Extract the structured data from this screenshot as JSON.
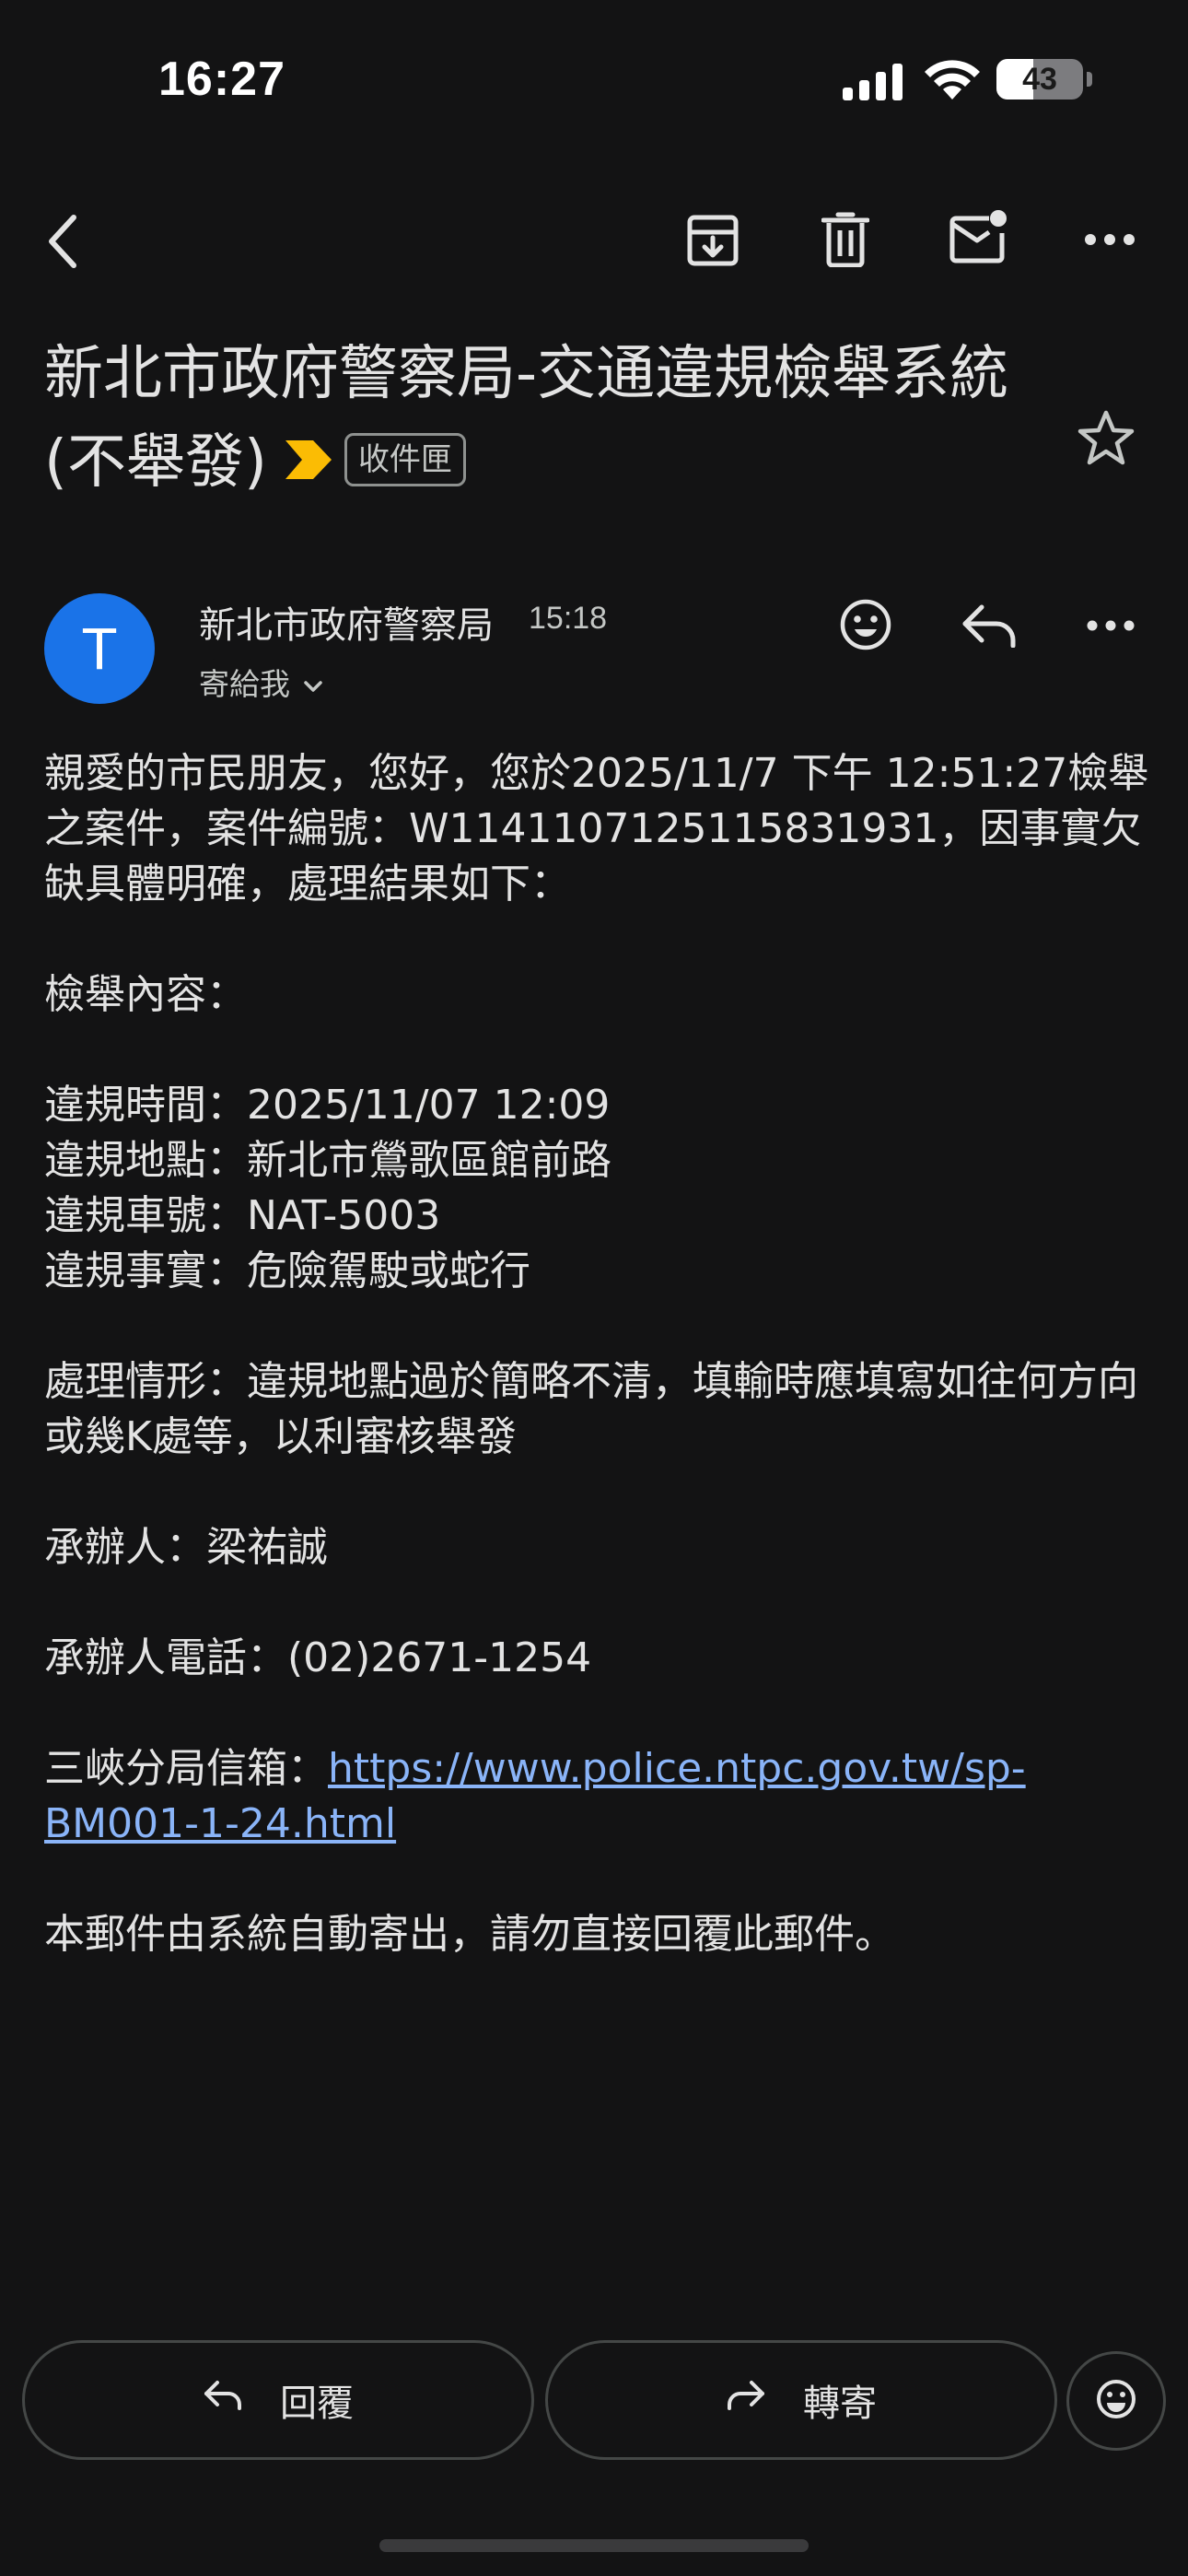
{
  "status_bar": {
    "time": "16:27",
    "battery_level": "43",
    "icons": [
      "signal-icon",
      "wifi-icon",
      "battery-icon"
    ]
  },
  "toolbar": {
    "icons": [
      "back-icon",
      "archive-icon",
      "delete-icon",
      "mark-unread-icon",
      "more-icon"
    ]
  },
  "email": {
    "subject": "新北市政府警察局-交通違規檢舉系統(不舉發)",
    "label": "收件匣",
    "sender_name": "新北市政府警察局",
    "sender_initial": "T",
    "time": "15:18",
    "recipient": "寄給我",
    "body": {
      "intro": "親愛的市民朋友，您好，您於2025/11/7 下午 12:51:27檢舉之案件，案件編號：W1141107125115831931，因事實欠缺具體明確，處理結果如下：",
      "content_heading": "檢舉內容：",
      "violation_time": "違規時間：2025/11/07 12:09",
      "violation_location": "違規地點：新北市鶯歌區館前路",
      "violation_plate": "違規車號：NAT-5003",
      "violation_fact": "違規事實：危險駕駛或蛇行",
      "handling": "處理情形：違規地點過於簡略不清，填輸時應填寫如往何方向或幾K處等，以利審核舉發",
      "handler": "承辦人：梁祐誠",
      "handler_phone": "承辦人電話：(02)2671-1254",
      "mailbox_label": "三峽分局信箱：",
      "mailbox_link": "https://www.police.ntpc.gov.tw/sp-BM001-1-24.html",
      "footer": "本郵件由系統自動寄出，請勿直接回覆此郵件。"
    }
  },
  "actions": {
    "reply_label": "回覆",
    "forward_label": "轉寄"
  },
  "colors": {
    "background": "#131314",
    "avatar": "#1a73e8",
    "link": "#8ab4f8",
    "important_marker": "#fbbc04"
  }
}
